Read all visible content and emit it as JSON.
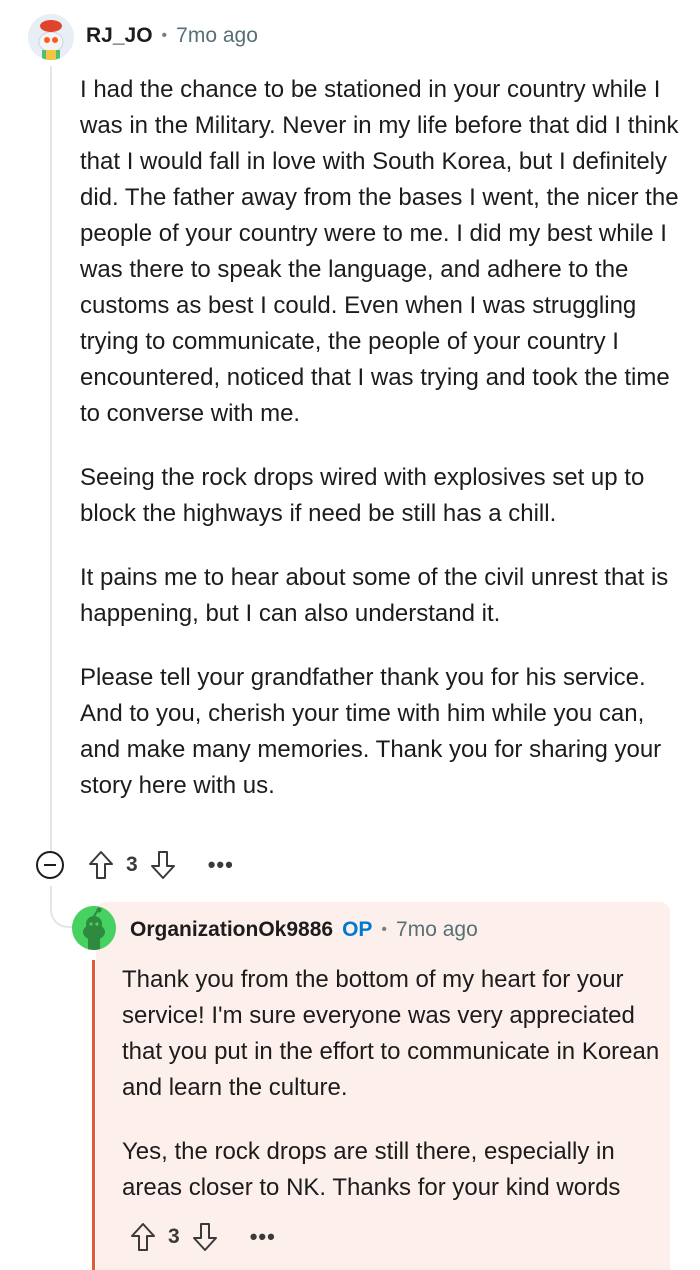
{
  "comment": {
    "username": "RJ_JO",
    "separator": "•",
    "time": "7mo ago",
    "paragraphs": [
      "I had the chance to be stationed in your country while I was in the Military. Never in my life before that did I think that I would fall in love with South Korea, but I definitely did. The father away from the bases I went, the nicer the people of your country were to me. I did my best while I was there to speak the language, and adhere to the customs as best I could. Even when I was struggling trying to communicate, the people of your country I encountered, noticed that I was trying and took the time to converse with me.",
      "Seeing the rock drops wired with explosives set up to block the highways if need be still has a chill.",
      "It pains me to hear about some of the civil unrest that is happening, but I can also understand it.",
      "Please tell your grandfather thank you for his service. And to you, cherish your time with him while you can, and make many memories. Thank you for sharing your story here with us."
    ],
    "votes": "3",
    "more": "•••",
    "icons": {
      "collapse": "collapse-icon",
      "upvote": "upvote-icon",
      "downvote": "downvote-icon",
      "more": "more-icon"
    }
  },
  "reply": {
    "username": "OrganizationOk9886",
    "op_label": "OP",
    "separator": "•",
    "time": "7mo ago",
    "paragraphs": [
      "Thank you from the bottom of my heart for your service! I'm sure everyone was very appreciated that you put in the effort to communicate in Korean and learn the culture.",
      "Yes, the rock drops are still there, especially in areas closer to NK. Thanks for your kind words"
    ],
    "votes": "3",
    "more": "•••"
  },
  "colors": {
    "op": "#0079d3",
    "highlight_bg": "#fdf0ec",
    "highlight_bar": "#e05a3a",
    "thread_line": "#e3e5e8"
  }
}
